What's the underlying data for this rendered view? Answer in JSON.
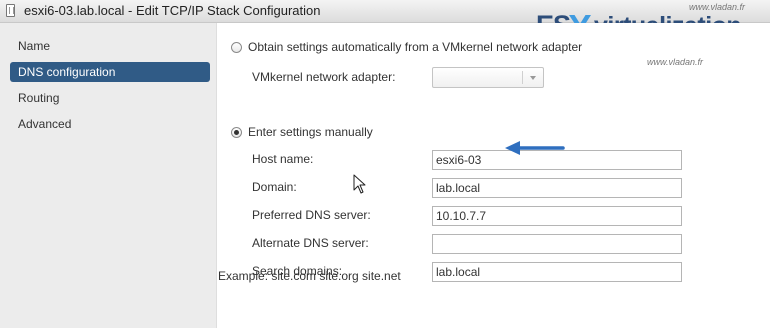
{
  "window": {
    "title": "esxi6-03.lab.local - Edit TCP/IP Stack Configuration"
  },
  "branding": {
    "logo_es": "ES",
    "logo_x": "X",
    "logo_rest": "virtualization",
    "site_top": "www.vladan.fr",
    "site_bottom": "www.vladan.fr"
  },
  "sidebar": {
    "items": [
      {
        "label": "Name",
        "active": false
      },
      {
        "label": "DNS configuration",
        "active": true
      },
      {
        "label": "Routing",
        "active": false
      },
      {
        "label": "Advanced",
        "active": false
      }
    ]
  },
  "main": {
    "option_auto": {
      "label": "Obtain settings automatically from a VMkernel network adapter",
      "checked": false,
      "adapter_label": "VMkernel network adapter:",
      "adapter_value": ""
    },
    "option_manual": {
      "label": "Enter settings manually",
      "checked": true
    },
    "fields": {
      "host_name": {
        "label": "Host name:",
        "value": "esxi6-03"
      },
      "domain": {
        "label": "Domain:",
        "value": "lab.local"
      },
      "preferred_dns": {
        "label": "Preferred DNS server:",
        "value": "10.10.7.7"
      },
      "alternate_dns": {
        "label": "Alternate DNS server:",
        "value": ""
      },
      "search_domains": {
        "label": "Search domains:",
        "value": "lab.local"
      }
    },
    "example": "Example: site.com site.org site.net"
  },
  "colors": {
    "accent": "#305b86",
    "arrow": "#2f6fbf",
    "logo_dark": "#2d4d79",
    "logo_light": "#3f9be0"
  },
  "icons": {
    "window": "host-icon",
    "arrow": "arrow-left-icon",
    "cursor": "mouse-pointer-icon"
  }
}
